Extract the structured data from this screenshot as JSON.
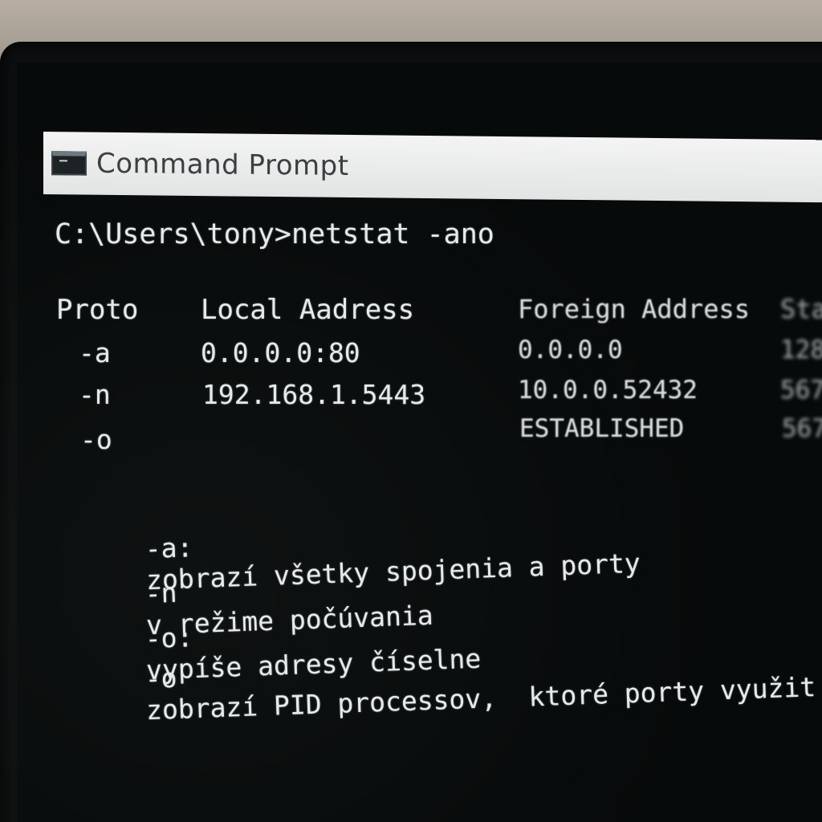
{
  "window": {
    "title": "Command Prompt",
    "icon": "cmd-window-icon"
  },
  "terminal": {
    "prompt": "C:\\Users\\tony>netstat -ano",
    "headers": {
      "proto": "Proto",
      "local": "Local Aadress",
      "foreign": "Foreign Address",
      "state": "Sta"
    },
    "rows": [
      {
        "proto": "-a",
        "local": "0.0.0.0:80",
        "foreign": "0.0.0.0",
        "state": "128"
      },
      {
        "proto": "-n",
        "local": "192.168.1.5443",
        "foreign": "10.0.0.52432",
        "state": "567"
      },
      {
        "proto": "-o",
        "local": "",
        "foreign": "ESTABLISHED",
        "state": "567"
      }
    ],
    "notes": [
      {
        "flag": "-a:",
        "text": "zobrazí všetky spojenia a porty"
      },
      {
        "flag": "-n",
        "text": "v režime počúvania"
      },
      {
        "flag": "-o:",
        "text": "vypíše adresy číselne"
      },
      {
        "flag": "-o",
        "text": "zobrazí PID processov,  ktoré porty využit"
      }
    ]
  }
}
